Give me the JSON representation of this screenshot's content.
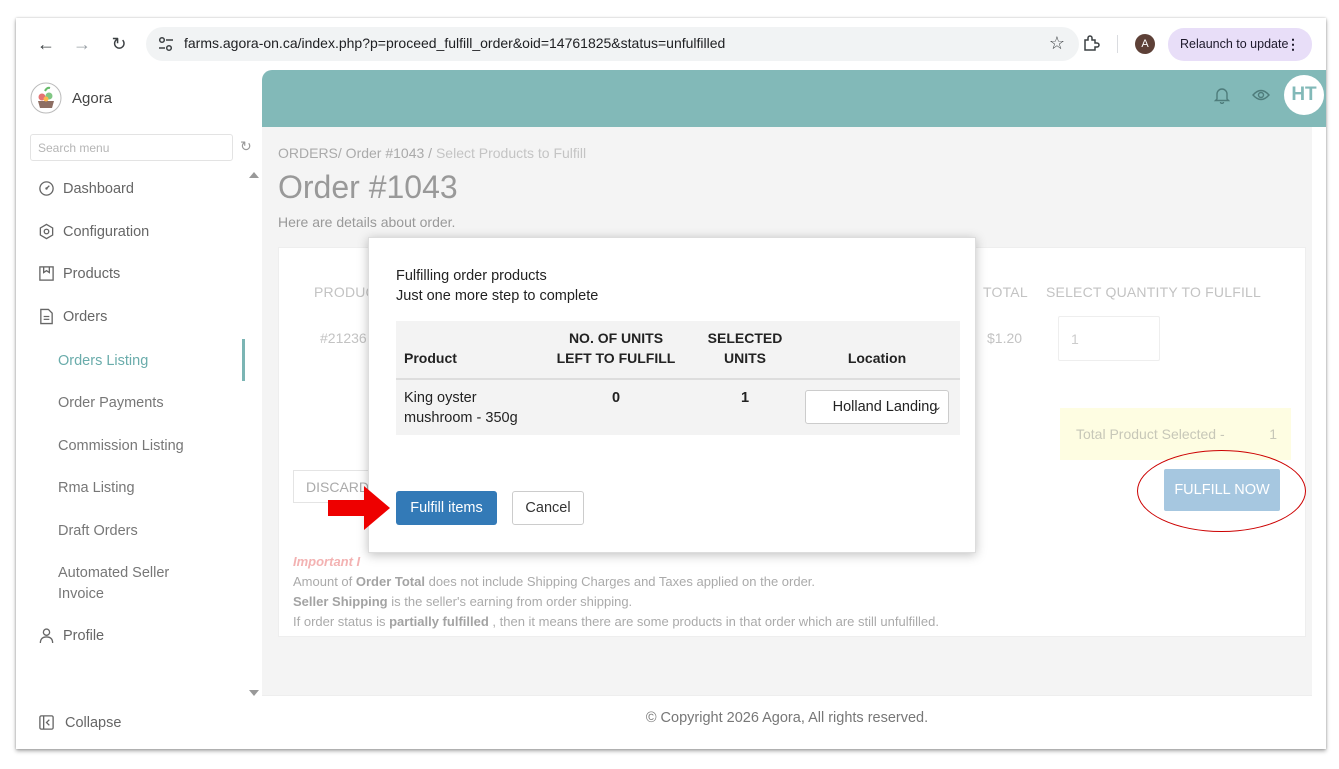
{
  "browser": {
    "url": "farms.agora-on.ca/index.php?p=proceed_fulfill_order&oid=14761825&status=unfulfilled",
    "profile_initial": "A",
    "relaunch_label": "Relaunch to update"
  },
  "sidebar": {
    "brand": "Agora",
    "search_placeholder": "Search menu",
    "items": [
      {
        "label": "Dashboard",
        "icon": "dashboard-icon"
      },
      {
        "label": "Configuration",
        "icon": "settings-hex-icon"
      },
      {
        "label": "Products",
        "icon": "products-icon"
      },
      {
        "label": "Orders",
        "icon": "orders-icon"
      }
    ],
    "order_subitems": [
      {
        "label": "Orders Listing",
        "active": true
      },
      {
        "label": "Order Payments"
      },
      {
        "label": "Commission Listing"
      },
      {
        "label": "Rma Listing"
      },
      {
        "label": "Draft Orders"
      },
      {
        "label": "Automated Seller Invoice"
      }
    ],
    "profile": "Profile",
    "collapse": "Collapse"
  },
  "header": {
    "user_initials": "HT",
    "accent_color": "#82b9b8"
  },
  "page": {
    "breadcrumb_root": "ORDERS/ Order #1043",
    "breadcrumb_sep": " / ",
    "breadcrumb_current": "Select Products to Fulfill",
    "title": "Order #1043",
    "subtitle": "Here are details about order.",
    "table_headers": {
      "product": "PRODUC",
      "total": "TOTAL",
      "select_qty": "SELECT QUANTITY TO FULFILL"
    },
    "row": {
      "id": "#21236",
      "total": "$1.20",
      "qty": "1"
    },
    "total_selected_label": "Total Product Selected -",
    "total_selected_value": "1",
    "discard_label": "DISCARD",
    "fulfill_now_label": "FULFILL NOW",
    "notes": {
      "important": "Important I",
      "line1_pre": "Amount of ",
      "line1_bold": "Order Total",
      "line1_post": " does not include Shipping Charges and Taxes applied on the order.",
      "line2_bold": "Seller Shipping",
      "line2_post": " is the seller's earning from order shipping.",
      "line3_pre": "If order status is ",
      "line3_bold": "partially fulfilled",
      "line3_post": " , then it means there are some products in that order which are still unfulfilled."
    },
    "footer": "© Copyright 2026 Agora, All rights reserved."
  },
  "modal": {
    "title_line1": "Fulfilling order products",
    "title_line2": "Just one more step to complete",
    "headers": {
      "product": "Product",
      "units_left_1": "NO. OF UNITS",
      "units_left_2": "LEFT TO FULFILL",
      "selected_1": "SELECTED",
      "selected_2": "UNITS",
      "location": "Location"
    },
    "row": {
      "product_line1": "King oyster",
      "product_line2": "mushroom - 350g",
      "units_left": "0",
      "selected_units": "1",
      "location": "Holland Landing"
    },
    "fulfill_label": "Fulfill items",
    "cancel_label": "Cancel",
    "primary_color": "#337ab7"
  },
  "annotations": {
    "arrow_color": "#ee0000",
    "circle_color": "#cc0000"
  }
}
